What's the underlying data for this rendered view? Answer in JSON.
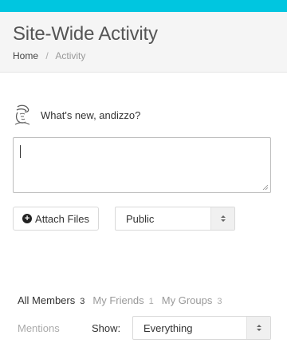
{
  "header": {
    "title": "Site-Wide Activity",
    "breadcrumb": [
      {
        "label": "Home"
      },
      {
        "label": "Activity"
      }
    ],
    "breadcrumb_separator": "/"
  },
  "post_form": {
    "prompt": "What's new, andizzo?",
    "textarea_value": "",
    "attach_label": "Attach Files",
    "privacy": {
      "selected": "Public"
    }
  },
  "filters": {
    "tabs": [
      {
        "label": "All Members",
        "count": "3",
        "active": true
      },
      {
        "label": "My Friends",
        "count": "1",
        "active": false
      },
      {
        "label": "My Groups",
        "count": "3",
        "active": false
      }
    ],
    "mentions_label": "Mentions",
    "show_label": "Show:",
    "show_selected": "Everything"
  },
  "colors": {
    "top_bar": "#00c6e0",
    "header_bg": "#f5f5f5"
  },
  "icons": {
    "avatar": "sketch-avatar",
    "attach": "plus-circle-icon",
    "select_arrow": "sort-arrows-icon"
  }
}
